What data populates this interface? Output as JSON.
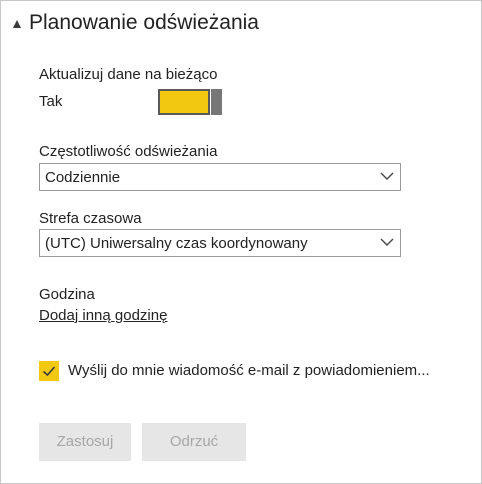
{
  "section": {
    "title": "Planowanie odświeżania",
    "collapse_icon": "triangle-expanded-icon"
  },
  "keep_updated": {
    "label": "Aktualizuj dane na bieżąco",
    "toggle_label": "Tak",
    "toggle_on": true
  },
  "frequency": {
    "label": "Częstotliwość odświeżania",
    "value": "Codziennie"
  },
  "timezone": {
    "label": "Strefa czasowa",
    "value": "(UTC) Uniwersalny czas koordynowany"
  },
  "time": {
    "label": "Godzina",
    "add_link": "Dodaj inną godzinę"
  },
  "notify": {
    "checked": true,
    "label": "Wyślij do mnie wiadomość e-mail z powiadomieniem..."
  },
  "buttons": {
    "apply": "Zastosuj",
    "discard": "Odrzuć"
  },
  "colors": {
    "accent": "#f2c811",
    "disabled_button_bg": "#e6e6e6",
    "disabled_button_text": "#a6a6a6"
  }
}
